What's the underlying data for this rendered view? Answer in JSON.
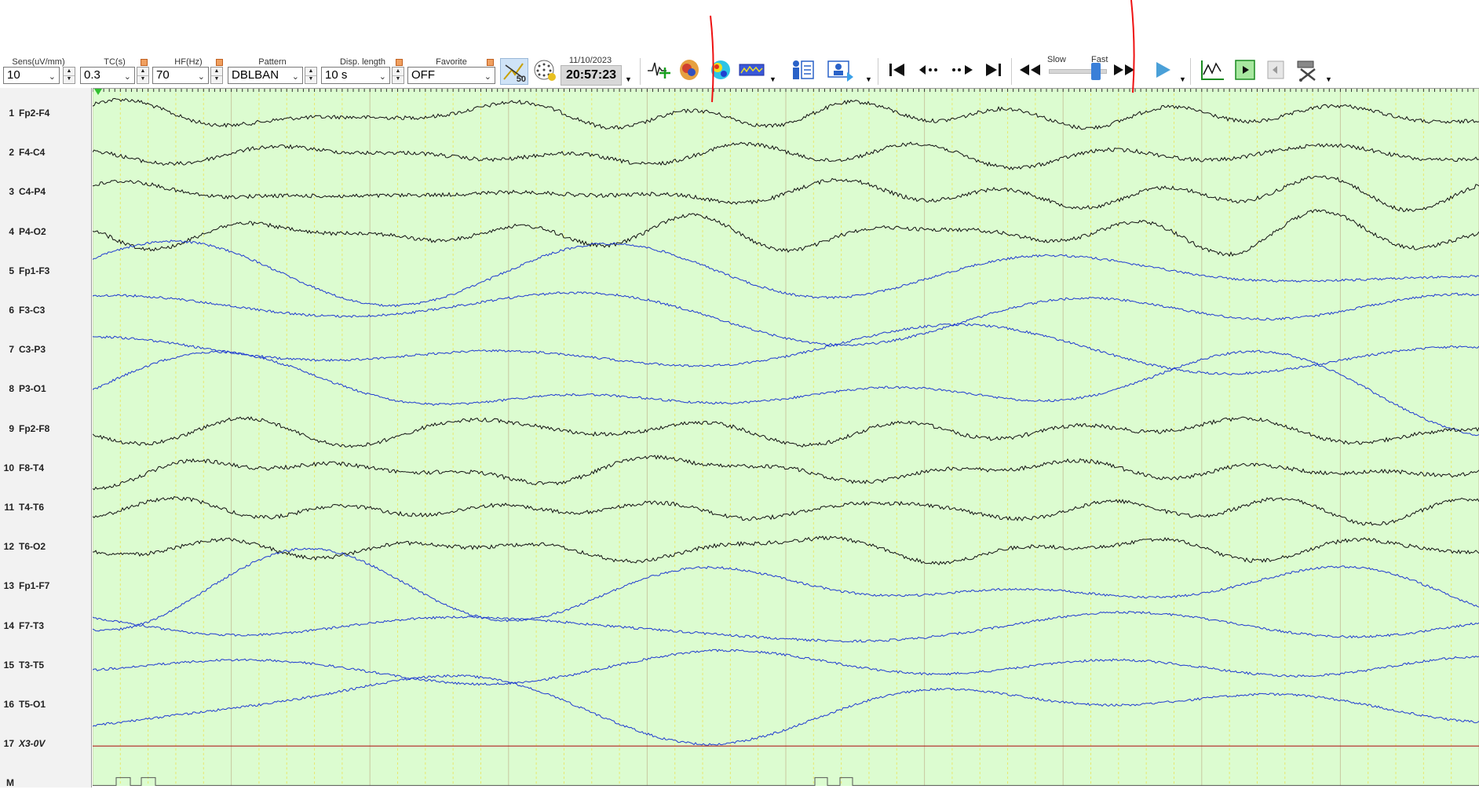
{
  "toolbar": {
    "sensitivity": {
      "label": "Sens(uV/mm)",
      "value": "10"
    },
    "tc": {
      "label": "TC(s)",
      "value": "0.3"
    },
    "hf": {
      "label": "HF(Hz)",
      "value": "70"
    },
    "pattern": {
      "label": "Pattern",
      "value": "DBLBAN"
    },
    "display_length": {
      "label": "Disp. length",
      "value": "10 s"
    },
    "favorite": {
      "label": "Favorite",
      "value": "OFF"
    },
    "badge": "50",
    "date": "11/10/2023",
    "time": "20:57:23",
    "speed_slow": "Slow",
    "speed_fast": "Fast",
    "icons": [
      "notch-filter-icon",
      "network-icon",
      "waveform-add-icon",
      "brain-3d-icon",
      "topo-map-icon",
      "spectrum-icon",
      "patient-report-icon",
      "video-icon",
      "go-start-icon",
      "step-back-icon",
      "step-forward-icon",
      "go-end-icon",
      "rewind-icon",
      "fast-forward-icon",
      "play-icon",
      "waveform-icon",
      "page-play-icon",
      "page-back-icon",
      "tools-icon"
    ]
  },
  "channels": [
    {
      "num": "1",
      "name": "Fp2-F4",
      "color": "#111111"
    },
    {
      "num": "2",
      "name": "F4-C4",
      "color": "#111111"
    },
    {
      "num": "3",
      "name": "C4-P4",
      "color": "#111111"
    },
    {
      "num": "4",
      "name": "P4-O2",
      "color": "#111111"
    },
    {
      "num": "5",
      "name": "Fp1-F3",
      "color": "#1f3ad0"
    },
    {
      "num": "6",
      "name": "F3-C3",
      "color": "#1f3ad0"
    },
    {
      "num": "7",
      "name": "C3-P3",
      "color": "#1f3ad0"
    },
    {
      "num": "8",
      "name": "P3-O1",
      "color": "#1f3ad0"
    },
    {
      "num": "9",
      "name": "Fp2-F8",
      "color": "#111111"
    },
    {
      "num": "10",
      "name": "F8-T4",
      "color": "#111111"
    },
    {
      "num": "11",
      "name": "T4-T6",
      "color": "#111111"
    },
    {
      "num": "12",
      "name": "T6-O2",
      "color": "#111111"
    },
    {
      "num": "13",
      "name": "Fp1-F7",
      "color": "#1f3ad0"
    },
    {
      "num": "14",
      "name": "F7-T3",
      "color": "#1f3ad0"
    },
    {
      "num": "15",
      "name": "T3-T5",
      "color": "#1f3ad0"
    },
    {
      "num": "16",
      "name": "T5-O1",
      "color": "#1f3ad0"
    },
    {
      "num": "17",
      "name": "X3-0V",
      "color": "#b02020"
    },
    {
      "num": "M",
      "name": "",
      "color": "#555555"
    }
  ],
  "colors": {
    "plot_bg": "#dcfcd0",
    "grid_second": "#c8c8a0",
    "grid_sub": "#e8e870",
    "marker": "#ee1111"
  }
}
